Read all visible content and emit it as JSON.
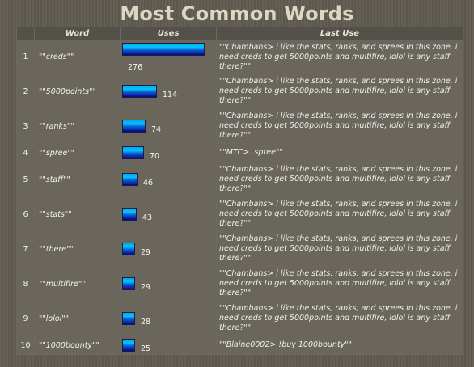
{
  "title": "Most Common Words",
  "columns": {
    "rank": "",
    "word": "Word",
    "uses": "Uses",
    "last": "Last Use"
  },
  "bar_max": 276,
  "rows": [
    {
      "rank": "1",
      "word": "\"\"creds\"\"",
      "uses": 276,
      "last": "\"\"Chambahs> i like the stats, ranks, and sprees in this zone, i need creds to get 5000points and multifire, lolol is any staff there?\"\""
    },
    {
      "rank": "2",
      "word": "\"\"5000points\"\"",
      "uses": 114,
      "last": "\"\"Chambahs> i like the stats, ranks, and sprees in this zone, i need creds to get 5000points and multifire, lolol is any staff there?\"\""
    },
    {
      "rank": "3",
      "word": "\"\"ranks\"\"",
      "uses": 74,
      "last": "\"\"Chambahs> i like the stats, ranks, and sprees in this zone, i need creds to get 5000points and multifire, lolol is any staff there?\"\""
    },
    {
      "rank": "4",
      "word": "\"\"spree\"\"",
      "uses": 70,
      "last": "\"\"MTC> .spree\"\""
    },
    {
      "rank": "5",
      "word": "\"\"staff\"\"",
      "uses": 46,
      "last": "\"\"Chambahs> i like the stats, ranks, and sprees in this zone, i need creds to get 5000points and multifire, lolol is any staff there?\"\""
    },
    {
      "rank": "6",
      "word": "\"\"stats\"\"",
      "uses": 43,
      "last": "\"\"Chambahs> i like the stats, ranks, and sprees in this zone, i need creds to get 5000points and multifire, lolol is any staff there?\"\""
    },
    {
      "rank": "7",
      "word": "\"\"there\"\"",
      "uses": 29,
      "last": "\"\"Chambahs> i like the stats, ranks, and sprees in this zone, i need creds to get 5000points and multifire, lolol is any staff there?\"\""
    },
    {
      "rank": "8",
      "word": "\"\"multifire\"\"",
      "uses": 29,
      "last": "\"\"Chambahs> i like the stats, ranks, and sprees in this zone, i need creds to get 5000points and multifire, lolol is any staff there?\"\""
    },
    {
      "rank": "9",
      "word": "\"\"lolol\"\"",
      "uses": 28,
      "last": "\"\"Chambahs> i like the stats, ranks, and sprees in this zone, i need creds to get 5000points and multifire, lolol is any staff there?\"\""
    },
    {
      "rank": "10",
      "word": "\"\"1000bounty\"\"",
      "uses": 25,
      "last": "\"\"Blaine0002> !buy 1000bounty\"\""
    }
  ]
}
